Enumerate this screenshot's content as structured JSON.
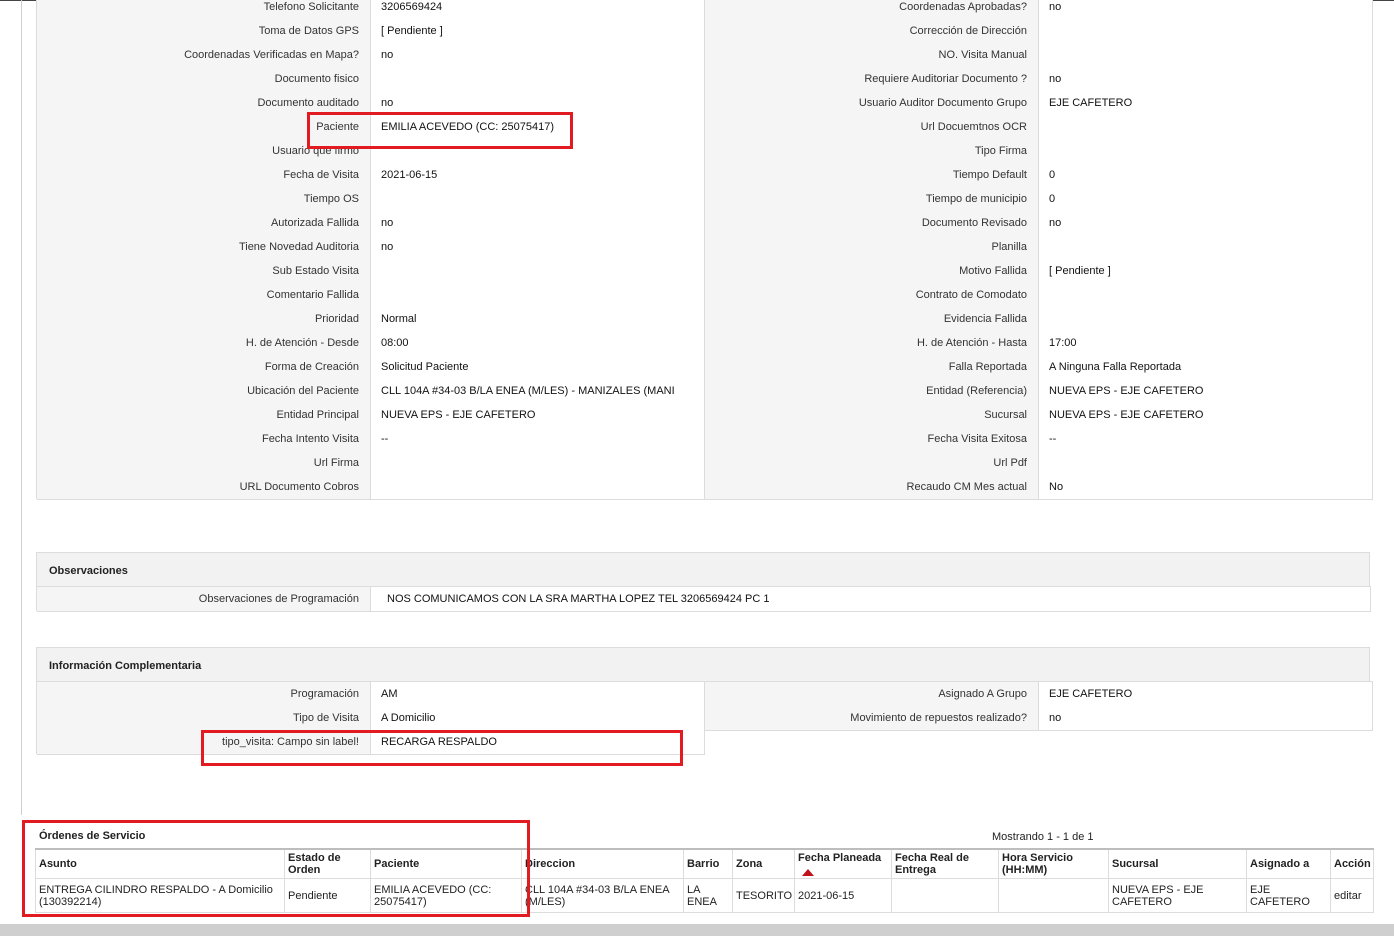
{
  "main_details": [
    [
      "Telefono Solicitante",
      "3206569424",
      "Coordenadas Aprobadas?",
      "no"
    ],
    [
      "Toma de Datos GPS",
      "[ Pendiente ]",
      "Corrección de Dirección",
      ""
    ],
    [
      "Coordenadas Verificadas en Mapa?",
      "no",
      "NO. Visita Manual",
      ""
    ],
    [
      "Documento fisico",
      "",
      "Requiere Auditoriar Documento ?",
      "no"
    ],
    [
      "Documento auditado",
      "no",
      "Usuario Auditor Documento Grupo",
      "EJE CAFETERO"
    ],
    [
      "Paciente",
      "EMILIA ACEVEDO (CC: 25075417)",
      "Url Docuemtnos OCR",
      ""
    ],
    [
      "Usuario que firmo",
      "",
      "Tipo Firma",
      ""
    ],
    [
      "Fecha de Visita",
      "2021-06-15",
      "Tiempo Default",
      "0"
    ],
    [
      "Tiempo OS",
      "",
      "Tiempo de municipio",
      "0"
    ],
    [
      "Autorizada Fallida",
      "no",
      "Documento Revisado",
      "no"
    ],
    [
      "Tiene Novedad Auditoria",
      "no",
      "Planilla",
      ""
    ],
    [
      "Sub Estado Visita",
      "",
      "Motivo Fallida",
      "[ Pendiente ]"
    ],
    [
      "Comentario Fallida",
      "",
      "Contrato de Comodato",
      ""
    ],
    [
      "Prioridad",
      "Normal",
      "Evidencia Fallida",
      ""
    ],
    [
      "H. de Atención - Desde",
      "08:00",
      "H. de Atención - Hasta",
      "17:00"
    ],
    [
      "Forma de Creación",
      "Solicitud Paciente",
      "Falla Reportada",
      "A Ninguna Falla Reportada"
    ],
    [
      "Ubicación del Paciente",
      "CLL 104A #34-03 B/LA ENEA (M/LES) - MANIZALES (MANI",
      "Entidad (Referencia)",
      "NUEVA EPS - EJE CAFETERO"
    ],
    [
      "Entidad Principal",
      "NUEVA EPS - EJE CAFETERO",
      "Sucursal",
      "NUEVA EPS - EJE CAFETERO"
    ],
    [
      "Fecha Intento Visita",
      "--",
      "Fecha Visita Exitosa",
      "--"
    ],
    [
      "Url Firma",
      "",
      "Url Pdf",
      ""
    ],
    [
      "URL Documento Cobros",
      "",
      "Recaudo CM Mes actual",
      "No"
    ]
  ],
  "observaciones": {
    "title": "Observaciones",
    "label": "Observaciones de Programación",
    "value": "NOS COMUNICAMOS CON LA SRA MARTHA LOPEZ TEL 3206569424 PC 1"
  },
  "info_complementaria": {
    "title": "Información Complementaria",
    "rows": [
      [
        "Programación",
        "AM",
        "Asignado A Grupo",
        "EJE CAFETERO"
      ],
      [
        "Tipo de Visita",
        "A Domicilio",
        "Movimiento de repuestos realizado?",
        "no"
      ],
      [
        "tipo_visita: Campo sin label!",
        "RECARGA RESPALDO",
        "",
        ""
      ]
    ]
  },
  "ordenes": {
    "title": "Órdenes de Servicio",
    "showing": "Mostrando 1 - 1 de 1",
    "columns": [
      "Asunto",
      "Estado de Orden",
      "Paciente",
      "Direccion",
      "Barrio",
      "Zona",
      "Fecha Planeada",
      "Fecha Real de Entrega",
      "Hora Servicio (HH:MM)",
      "Sucursal",
      "Asignado a",
      "Acción"
    ],
    "rows": [
      [
        "ENTREGA CILINDRO RESPALDO - A Domicilio (130392214)",
        "Pendiente",
        "EMILIA ACEVEDO (CC: 25075417)",
        "CLL 104A #34-03 B/LA ENEA (M/LES)",
        "LA ENEA",
        "TESORITO",
        "2021-06-15",
        "",
        "",
        "NUEVA EPS - EJE CAFETERO",
        "EJE CAFETERO",
        "editar"
      ]
    ]
  },
  "colors": {
    "highlight": "#e21b23",
    "label_bg": "#f5f5f5",
    "border": "#dcdcdc"
  }
}
